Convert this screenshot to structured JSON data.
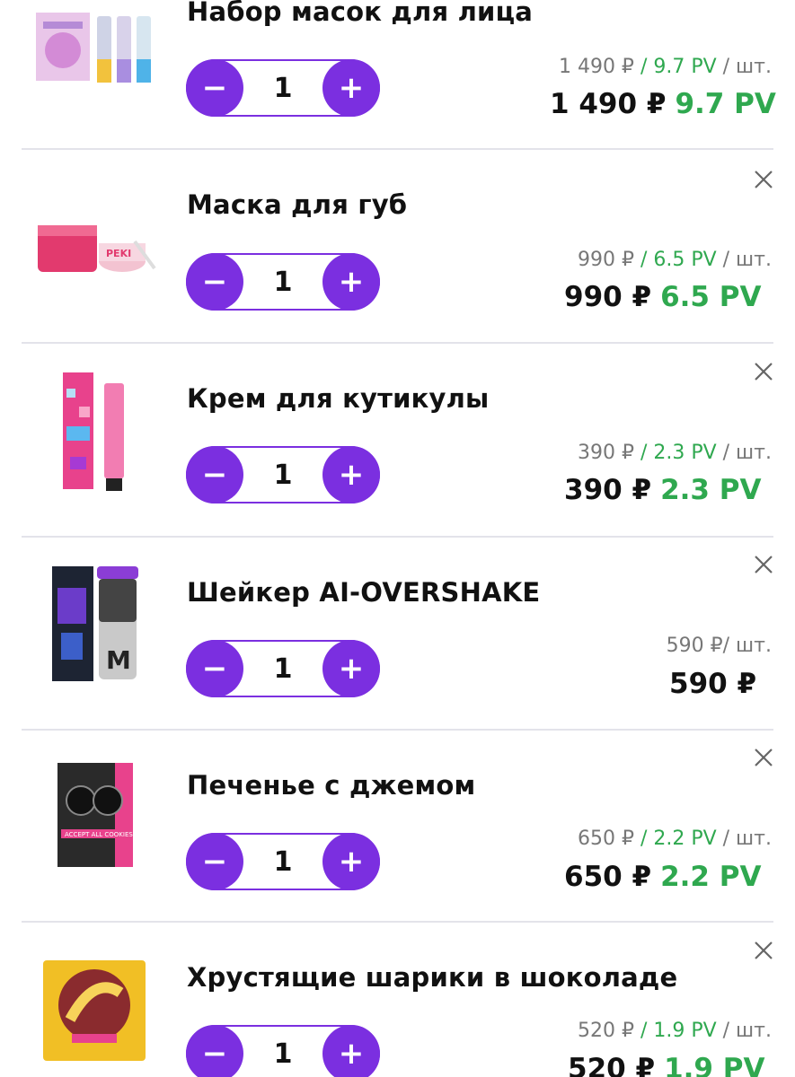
{
  "cart": {
    "qty_minus": "−",
    "qty_plus": "+",
    "items": [
      {
        "title": "Набор масок для лица",
        "qty": "1",
        "unit_price": "1 490 ₽",
        "unit_pv": "/ 9.7 PV",
        "per": "/ шт.",
        "total_price": "1 490 ₽",
        "total_pv": "9.7 PV",
        "image": "face-masks-set"
      },
      {
        "title": "Маска для губ",
        "qty": "1",
        "unit_price": "990 ₽",
        "unit_pv": "/ 6.5 PV",
        "per": "/ шт.",
        "total_price": "990 ₽",
        "total_pv": "6.5 PV",
        "image": "lip-mask"
      },
      {
        "title": "Крем для кутикулы",
        "qty": "1",
        "unit_price": "390 ₽",
        "unit_pv": "/ 2.3 PV",
        "per": "/ шт.",
        "total_price": "390 ₽",
        "total_pv": "2.3 PV",
        "image": "cuticle-cream"
      },
      {
        "title": "Шейкер AI-OVERSHAKE",
        "qty": "1",
        "unit_price": "590 ₽",
        "unit_pv": "",
        "per": "/ шт.",
        "total_price": "590 ₽",
        "total_pv": "",
        "image": "shaker"
      },
      {
        "title": "Печенье с джемом",
        "qty": "1",
        "unit_price": "650 ₽",
        "unit_pv": "/ 2.2 PV",
        "per": "/ шт.",
        "total_price": "650 ₽",
        "total_pv": "2.2 PV",
        "image": "cookies"
      },
      {
        "title": "Хрустящие шарики в шоколаде",
        "qty": "1",
        "unit_price": "520 ₽",
        "unit_pv": "/ 1.9 PV",
        "per": "/ шт.",
        "total_price": "520 ₽",
        "total_pv": "1.9 PV",
        "image": "chocolate-balls"
      }
    ]
  },
  "colors": {
    "accent": "#7b2fe0",
    "pv": "#2fa84f",
    "separator": "#e3e3ea",
    "muted": "#777777"
  }
}
